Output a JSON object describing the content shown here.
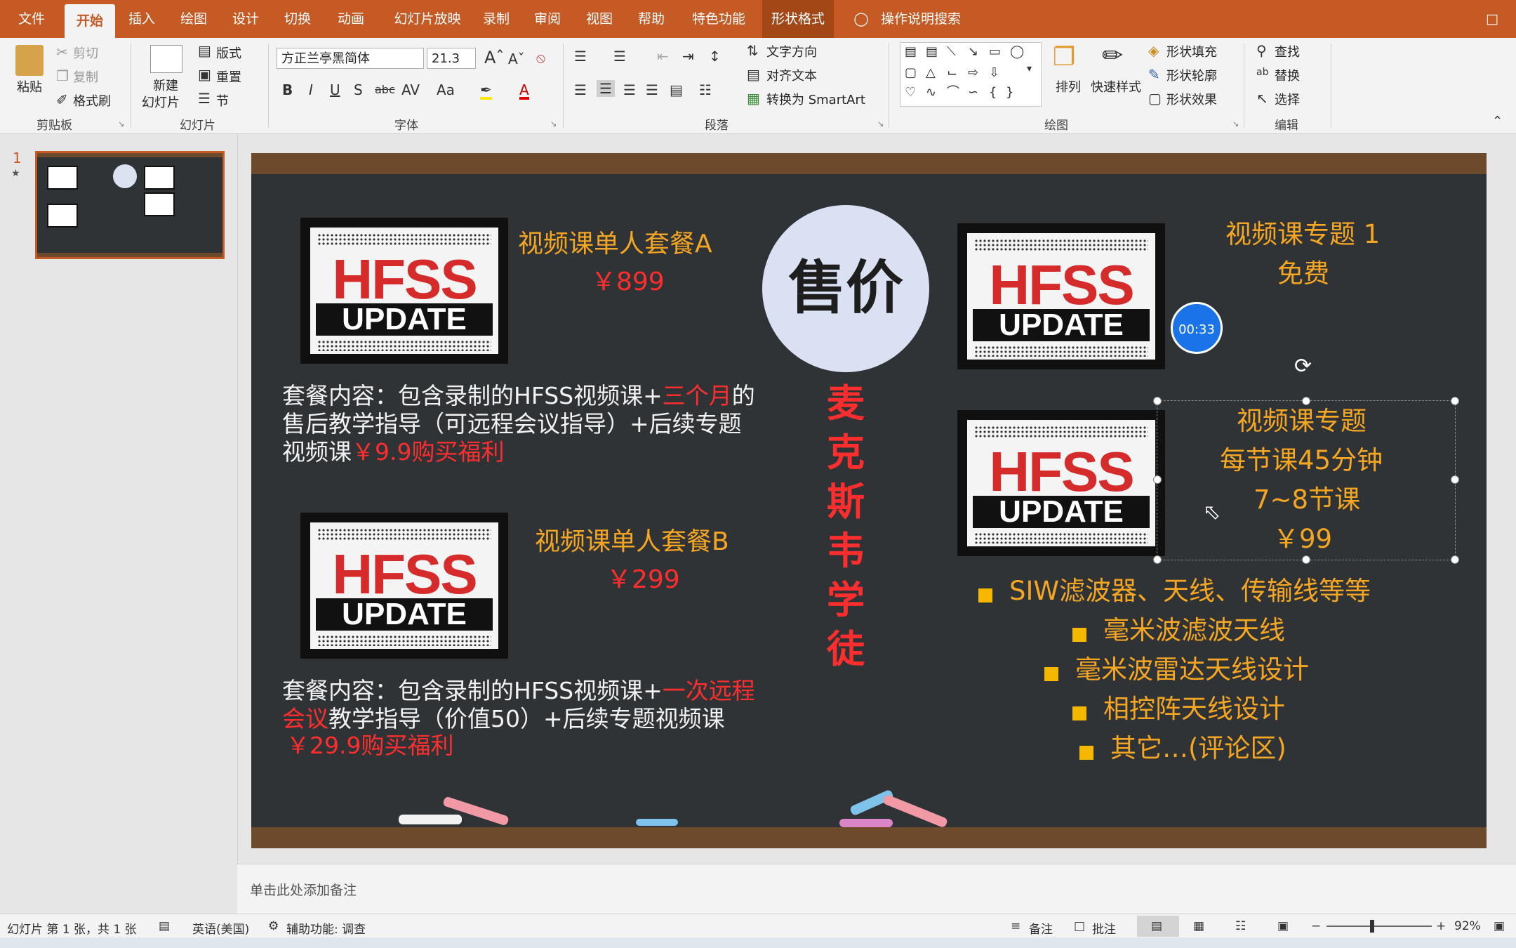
{
  "tabs": [
    "文件",
    "开始",
    "插入",
    "绘图",
    "设计",
    "切换",
    "动画",
    "幻灯片放映",
    "录制",
    "审阅",
    "视图",
    "帮助",
    "特色功能",
    "形状格式"
  ],
  "search_label": "操作说明搜索",
  "ribbon": {
    "clipboard": {
      "paste": "粘贴",
      "cut": "剪切",
      "copy": "复制",
      "format_painter": "格式刷",
      "title": "剪贴板"
    },
    "slides": {
      "new_slide_1": "新建",
      "new_slide_2": "幻灯片",
      "layout": "版式",
      "reset": "重置",
      "section": "节",
      "title": "幻灯片"
    },
    "font": {
      "name": "方正兰亭黑简体",
      "size": "21.3",
      "title": "字体"
    },
    "paragraph": {
      "text_direction": "文字方向",
      "align_text": "对齐文本",
      "smartart": "转换为 SmartArt",
      "title": "段落"
    },
    "drawing": {
      "arrange": "排列",
      "quick_styles": "快速样式",
      "fill": "形状填充",
      "outline": "形状轮廓",
      "effects": "形状效果",
      "title": "绘图"
    },
    "editing": {
      "find": "查找",
      "replace": "替换",
      "select": "选择",
      "title": "编辑"
    }
  },
  "slide_number": "1",
  "slide": {
    "a_title": "视频课单人套餐A",
    "a_price": "￥899",
    "a_desc_1": "套餐内容：包含录制的HFSS视频课+",
    "a_desc_1_red": "三个月",
    "a_desc_1_end": "的",
    "a_desc_2": "售后教学指导（可远程会议指导）+后续专题",
    "a_desc_3": "视频课",
    "a_desc_3_red": "￥9.9购买福利",
    "b_title": "视频课单人套餐B",
    "b_price": "￥299",
    "b_desc_1": "套餐内容：包含录制的HFSS视频课+",
    "b_desc_1_red": "一次远程",
    "b_desc_2_red": "会议",
    "b_desc_2": "教学指导（价值50）+后续专题视频课",
    "b_desc_3_red": "￥29.9购买福利",
    "center_circle": "售价",
    "vertical_text": [
      "麦",
      "克",
      "斯",
      "韦",
      "学",
      "徒"
    ],
    "r1_title": "视频课专题 1",
    "r1_price": "免费",
    "timer": "00:33",
    "r2_lines": [
      "视频课专题",
      "每节课45分钟",
      "7~8节课",
      "￥99"
    ],
    "bullets": [
      "SIW滤波器、天线、传输线等等",
      "毫米波滤波天线",
      "毫米波雷达天线设计",
      "相控阵天线设计",
      "其它…(评论区)"
    ],
    "logo_hfss": "HFSS",
    "logo_update": "UPDATE"
  },
  "notes_placeholder": "单击此处添加备注",
  "status": {
    "slide_info": "幻灯片 第 1 张，共 1 张",
    "language": "英语(美国)",
    "accessibility": "辅助功能: 调查",
    "notes": "备注",
    "comments": "批注",
    "zoom": "92%"
  }
}
